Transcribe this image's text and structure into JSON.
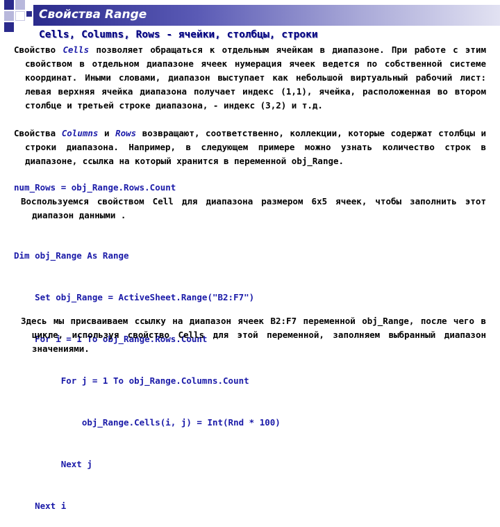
{
  "slide": {
    "title": "Свойства Range",
    "subtitle": "Cells, Columns, Rows - ячейки, столбцы, строки",
    "para1": {
      "lead": "Свойство ",
      "keyword": "Cells",
      "rest": " позволяет обращаться к отдельным ячейкам в диапазоне. При работе с этим свойством в отдельном диапазоне ячеек нумерация ячеек ведется по собственной системе координат. Иными словами, диапазон выступает как небольшой виртуальный рабочий лист: левая верхняя ячейка диапазона получает индекс (1,1), ячейка, расположенная во втором столбце и третьей строке диапазона, - индекс (3,2) и т.д."
    },
    "para2": {
      "lead": "Свойства ",
      "keyword1": "Columns",
      "mid": " и ",
      "keyword2": "Rows",
      "rest": " возвращают, соответственно, коллекции, которые содержат столбцы и строки диапазона. Например, в следующем примере можно узнать количество строк в диапазоне, ссылка на который хранится в переменной obj_Range."
    },
    "code1": "num_Rows = obj_Range.Rows.Count",
    "para3": "Воспользуемся свойством Cell для диапазона размером 6х5 ячеек, чтобы заполнить этот диапазон данными .",
    "code2": [
      "Dim obj_Range As Range",
      "    Set obj_Range = ActiveSheet.Range(\"B2:F7\")",
      "    For i = 1 To obj_Range.Rows.Count",
      "         For j = 1 To obj_Range.Columns.Count",
      "             obj_Range.Cells(i, j) = Int(Rnd * 100)",
      "         Next j",
      "    Next i"
    ],
    "para4": "Здесь мы присваиваем ссылку на диапазон ячеек B2:F7 переменной obj_Range, после чего в цикле, используя свойство Cells для этой переменной, заполняем выбранный диапазон значениями."
  },
  "colors": {
    "title_bar_start": "#2b2b8c",
    "title_bar_end": "#e2e2f2",
    "heading": "#000080",
    "code": "#1a1aa8"
  }
}
